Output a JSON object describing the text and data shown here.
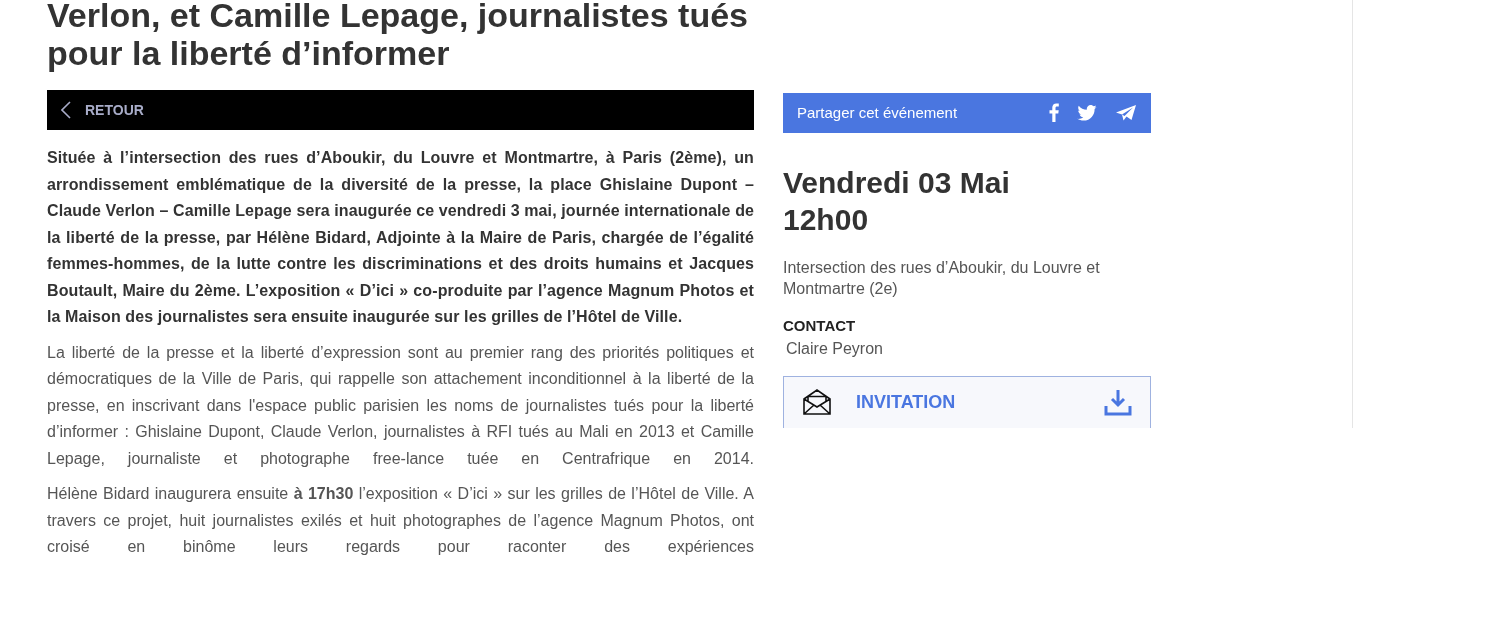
{
  "title": "Verlon, et Camille Lepage, journalistes tués pour la liberté d’informer",
  "back_bar": {
    "label": "RETOUR"
  },
  "paragraphs": [
    {
      "kind": "lead",
      "text": "Située à l’intersection des rues d’Aboukir, du Louvre et Montmartre, à Paris (2ème), un arrondissement emblématique de la diversité de la presse, la place Ghislaine Dupont – Claude Verlon – Camille Lepage  sera inaugurée ce vendredi 3 mai, journée internationale de la liberté de la presse, par Hélène Bidard, Adjointe à la Maire de Paris, chargée de l’égalité femmes-hommes, de la lutte contre les discriminations et des droits humains et Jacques Boutault, Maire du 2ème. L’exposition « D’ici » co-produite par l’agence Magnum Photos et la Maison des journalistes sera ensuite inaugurée sur les grilles de l’Hôtel de Ville."
    },
    {
      "kind": "body",
      "text": "La liberté de la presse et la liberté d’expression sont au premier rang des priorités politiques et démocratiques de la Ville de Paris, qui rappelle son attachement inconditionnel  à la liberté de la presse, en inscrivant dans l'espace public parisien les noms de journalistes tués pour la liberté d’informer : Ghislaine Dupont, Claude Verlon, journalistes à RFI tués au Mali en 2013 et Camille Lepage, journaliste et photographe free-lance tuée en Centrafrique en 2014."
    },
    {
      "kind": "body",
      "text": "Hélène Bidard inaugurera ensuite **à 17h30** l’exposition « D’ici » sur les grilles de l’Hôtel de Ville. A travers ce projet, huit journalistes exilés et huit photographes de l’agence Magnum Photos, ont croisé en binôme leurs regards pour raconter des expériences"
    }
  ],
  "share_bar": {
    "label": "Partager cet événement"
  },
  "event": {
    "date": "Vendredi 03 Mai",
    "time": "12h00",
    "address": "Intersection des rues d’Aboukir, du Louvre et Montmartre (2e)",
    "contact_label": "CONTACT",
    "contact_name": "Claire Peyron"
  },
  "invitation": {
    "label": "INVITATION"
  }
}
